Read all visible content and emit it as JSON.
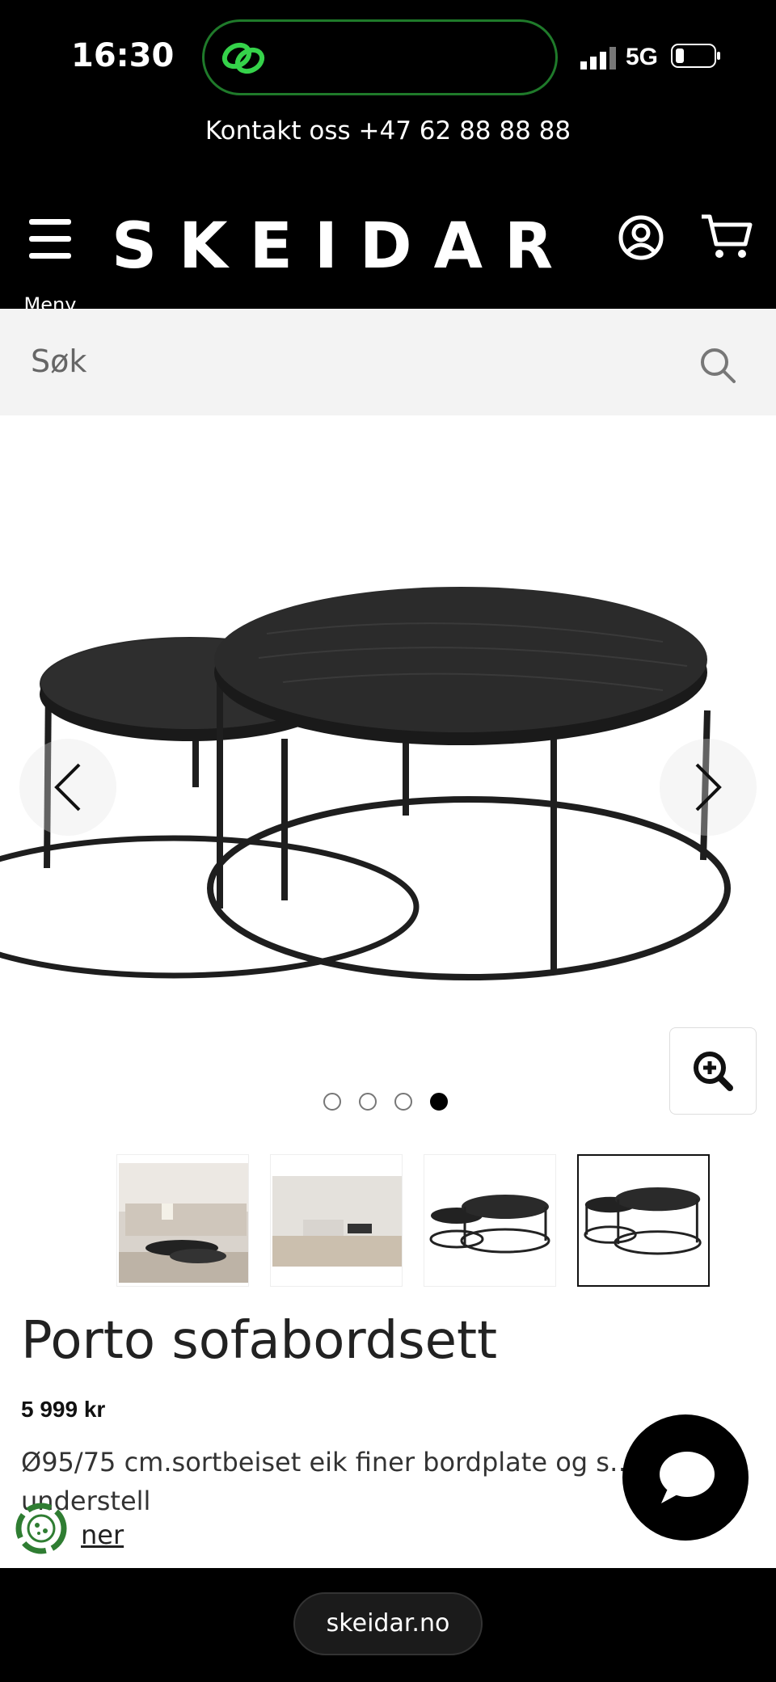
{
  "status_bar": {
    "time": "16:30",
    "network": "5G"
  },
  "top_strip": {
    "contact": "Kontakt oss +47 62 88 88 88"
  },
  "header": {
    "logo": "SKEIDAR",
    "menu_label": "Meny"
  },
  "search": {
    "placeholder": "Søk"
  },
  "gallery": {
    "slide_count": 4,
    "active_slide": 4
  },
  "product": {
    "title": "Porto sofabordsett",
    "price": "5 999 kr",
    "description": "Ø95/75 cm.sortbeiset eik finer bordplate og s… understell",
    "read_more": "ner"
  },
  "browser": {
    "url": "skeidar.no"
  },
  "colors": {
    "background": "#000000",
    "accent": "#1f7a2a",
    "chat": "#000000"
  }
}
